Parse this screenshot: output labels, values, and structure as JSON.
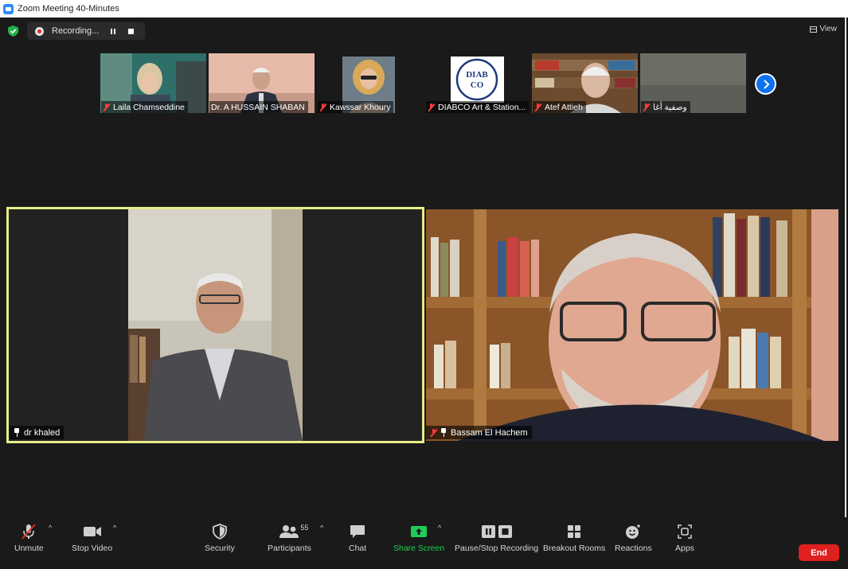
{
  "window": {
    "title": "Zoom Meeting 40-Minutes"
  },
  "top_bar": {
    "recording_label": "Recording...",
    "view_label": "View"
  },
  "gallery": [
    {
      "name": "Laila Chamseddine",
      "muted": true
    },
    {
      "name": "Dr. A HUSSAIN SHABAN",
      "muted": false
    },
    {
      "name": "Kawssar Khoury",
      "muted": true
    },
    {
      "name": "DIABCO Art & Station...",
      "muted": true,
      "logo_lines": [
        "DIAB",
        "CO"
      ]
    },
    {
      "name": "Atef Attieh",
      "muted": true
    },
    {
      "name": "وصفية أغا",
      "muted": true
    }
  ],
  "main_tiles": [
    {
      "name": "dr khaled",
      "active_speaker": true,
      "pinned": true,
      "muted": false
    },
    {
      "name": "Bassam El Hachem",
      "active_speaker": false,
      "pinned": true,
      "muted": true
    }
  ],
  "toolbar": {
    "unmute": "Unmute",
    "stop_video": "Stop Video",
    "security": "Security",
    "participants": "Participants",
    "participants_count": "55",
    "chat": "Chat",
    "share_screen": "Share Screen",
    "pause_stop_recording": "Pause/Stop Recording",
    "breakout_rooms": "Breakout Rooms",
    "reactions": "Reactions",
    "apps": "Apps",
    "end": "End"
  },
  "colors": {
    "accent_blue": "#0e72ed",
    "share_green": "#1fcc55",
    "end_red": "#e01f1f",
    "speaker_border": "#e6ed8a",
    "muted_red": "#ff3b3b"
  }
}
